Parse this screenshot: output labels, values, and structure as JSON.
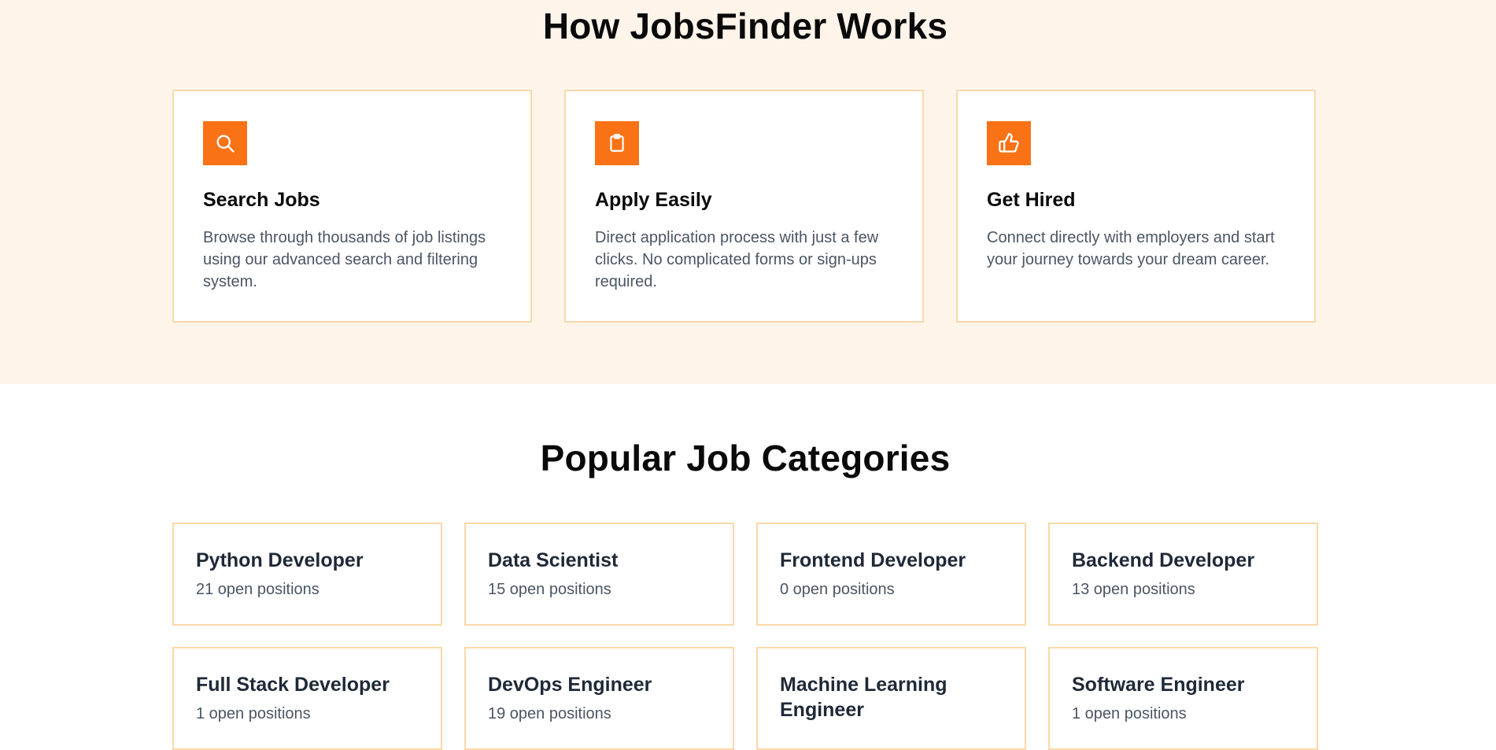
{
  "how_it_works": {
    "title": "How JobsFinder Works",
    "steps": [
      {
        "icon": "search-icon",
        "title": "Search Jobs",
        "description": "Browse through thousands of job listings using our advanced search and filtering system."
      },
      {
        "icon": "clipboard-icon",
        "title": "Apply Easily",
        "description": "Direct application process with just a few clicks. No complicated forms or sign-ups required."
      },
      {
        "icon": "thumbs-up-icon",
        "title": "Get Hired",
        "description": "Connect directly with employers and start your journey towards your dream career."
      }
    ]
  },
  "categories": {
    "title": "Popular Job Categories",
    "items": [
      {
        "name": "Python Developer",
        "count": "21 open positions"
      },
      {
        "name": "Data Scientist",
        "count": "15 open positions"
      },
      {
        "name": "Frontend Developer",
        "count": "0 open positions"
      },
      {
        "name": "Backend Developer",
        "count": "13 open positions"
      },
      {
        "name": "Full Stack Developer",
        "count": "1 open positions"
      },
      {
        "name": "DevOps Engineer",
        "count": "19 open positions"
      },
      {
        "name": "Machine Learning Engineer",
        "count": ""
      },
      {
        "name": "Software Engineer",
        "count": "1 open positions"
      }
    ]
  },
  "colors": {
    "accent": "#f97316",
    "section_background": "#fef4ea",
    "card_border": "#fbd8a8"
  }
}
